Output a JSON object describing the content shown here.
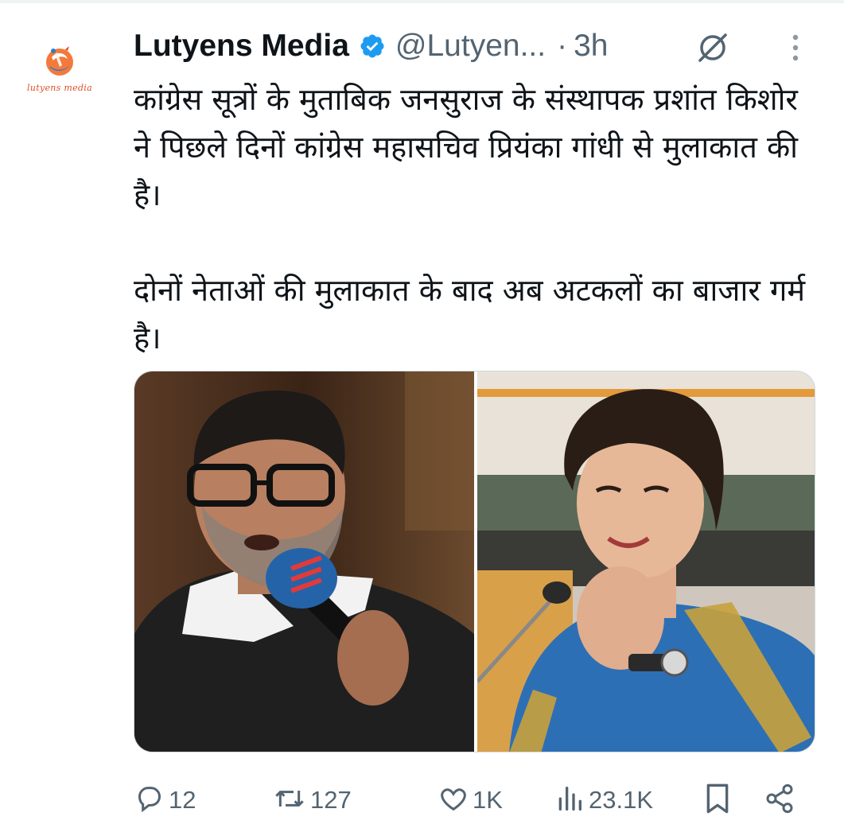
{
  "author": {
    "display_name": "Lutyens Media",
    "handle": "@Lutyen...",
    "separator": "·",
    "time": "3h",
    "verified": true,
    "avatar_caption": "lutyens media"
  },
  "tweet": {
    "paragraph_1": "कांग्रेस सूत्रों के मुताबिक जनसुराज के संस्थापक प्रशांत किशोर ने पिछले दिनों कांग्रेस महासचिव प्रियंका गांधी से मुलाकात की है।",
    "paragraph_2": "दोनों नेताओं की मुलाकात के बाद अब अटकलों का बाजार गर्म है।"
  },
  "media": {
    "left_image": "photo-man-speaking-into-microphone",
    "right_image": "photo-woman-in-blue-saree-smiling"
  },
  "actions": {
    "replies": "12",
    "reposts": "127",
    "likes": "1K",
    "views": "23.1K"
  },
  "icons": {
    "verified": "verified-badge-icon",
    "grok": "grok-icon",
    "more": "more-vertical-icon",
    "reply": "reply-icon",
    "repost": "repost-icon",
    "like": "heart-icon",
    "views": "views-icon",
    "bookmark": "bookmark-icon",
    "share": "share-icon"
  },
  "colors": {
    "verified_blue": "#1d9bf0",
    "text_primary": "#0f1419",
    "text_secondary": "#536471",
    "brand_orange": "#e0502a"
  }
}
